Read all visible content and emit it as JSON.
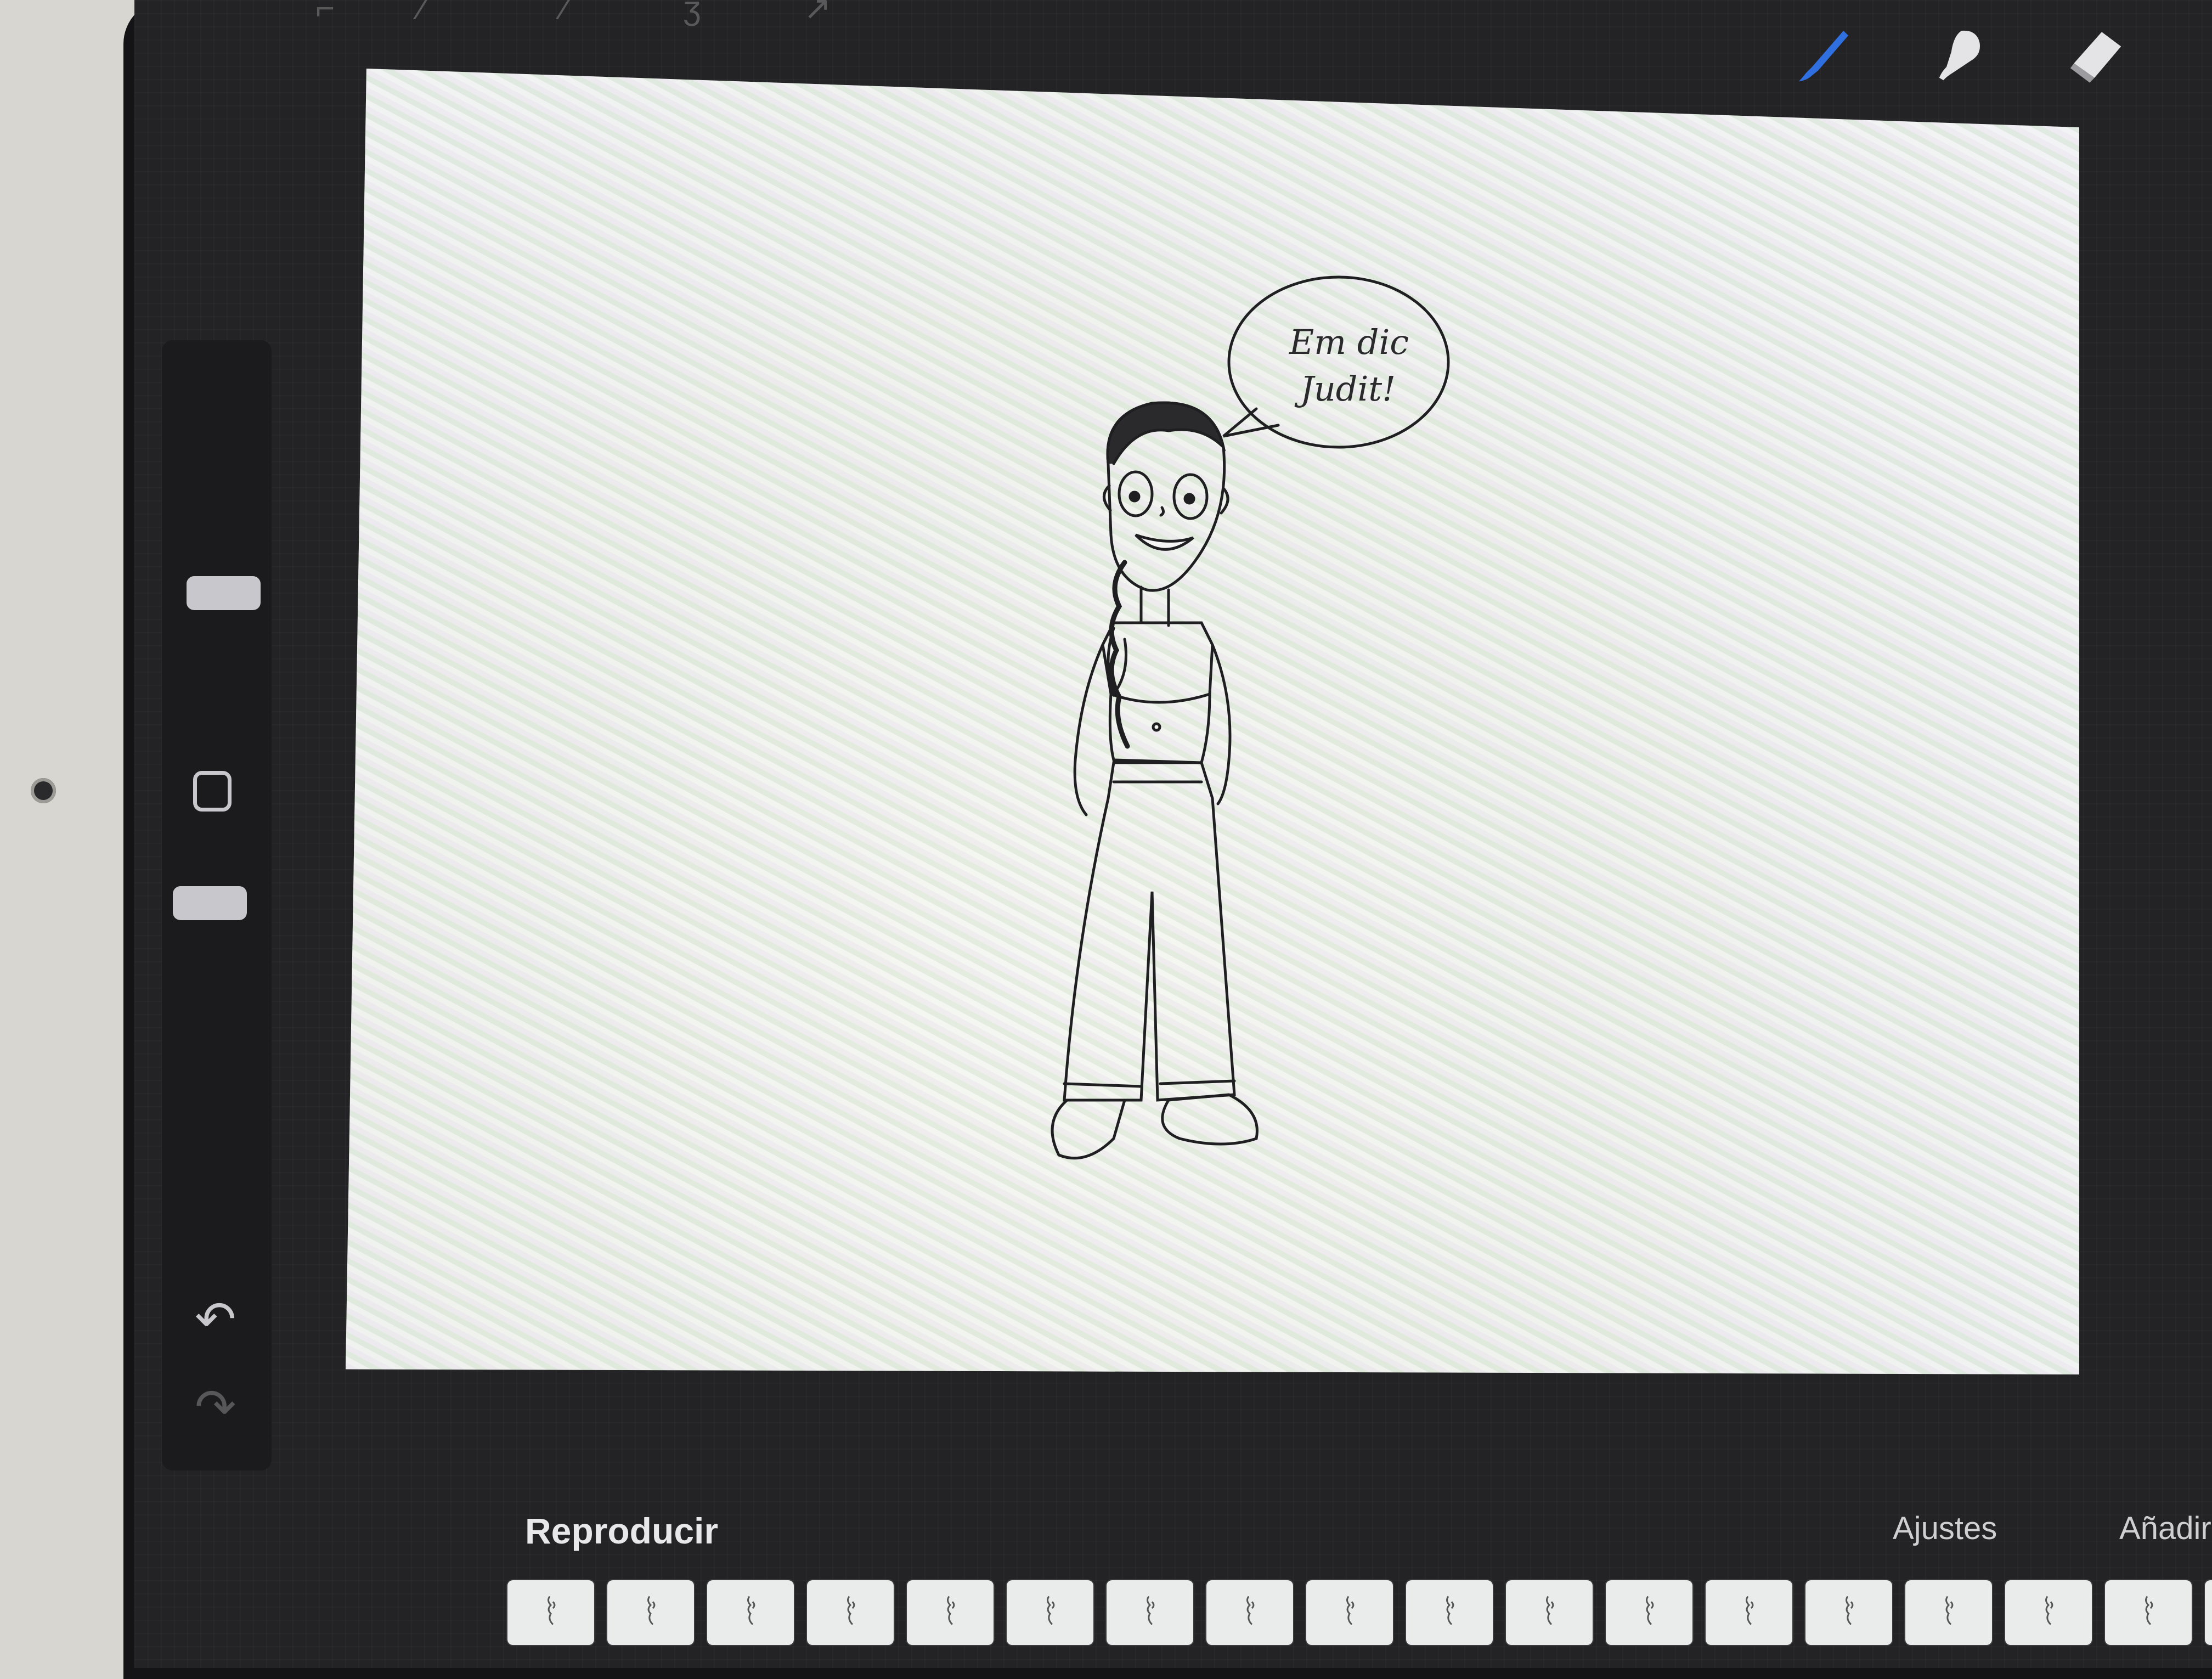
{
  "timeline": {
    "play_label": "Reproducir",
    "settings_label": "Ajustes",
    "add_frame_label": "Añadir fotograma"
  },
  "canvas": {
    "speech_bubble_line1": "Em dic",
    "speech_bubble_line2": "Judit!"
  },
  "toolbar": {
    "tools": [
      "paint-brush-icon",
      "smudge-icon",
      "eraser-icon"
    ],
    "active_tool": "paint-brush-icon",
    "active_color": "#2f6fe0"
  }
}
